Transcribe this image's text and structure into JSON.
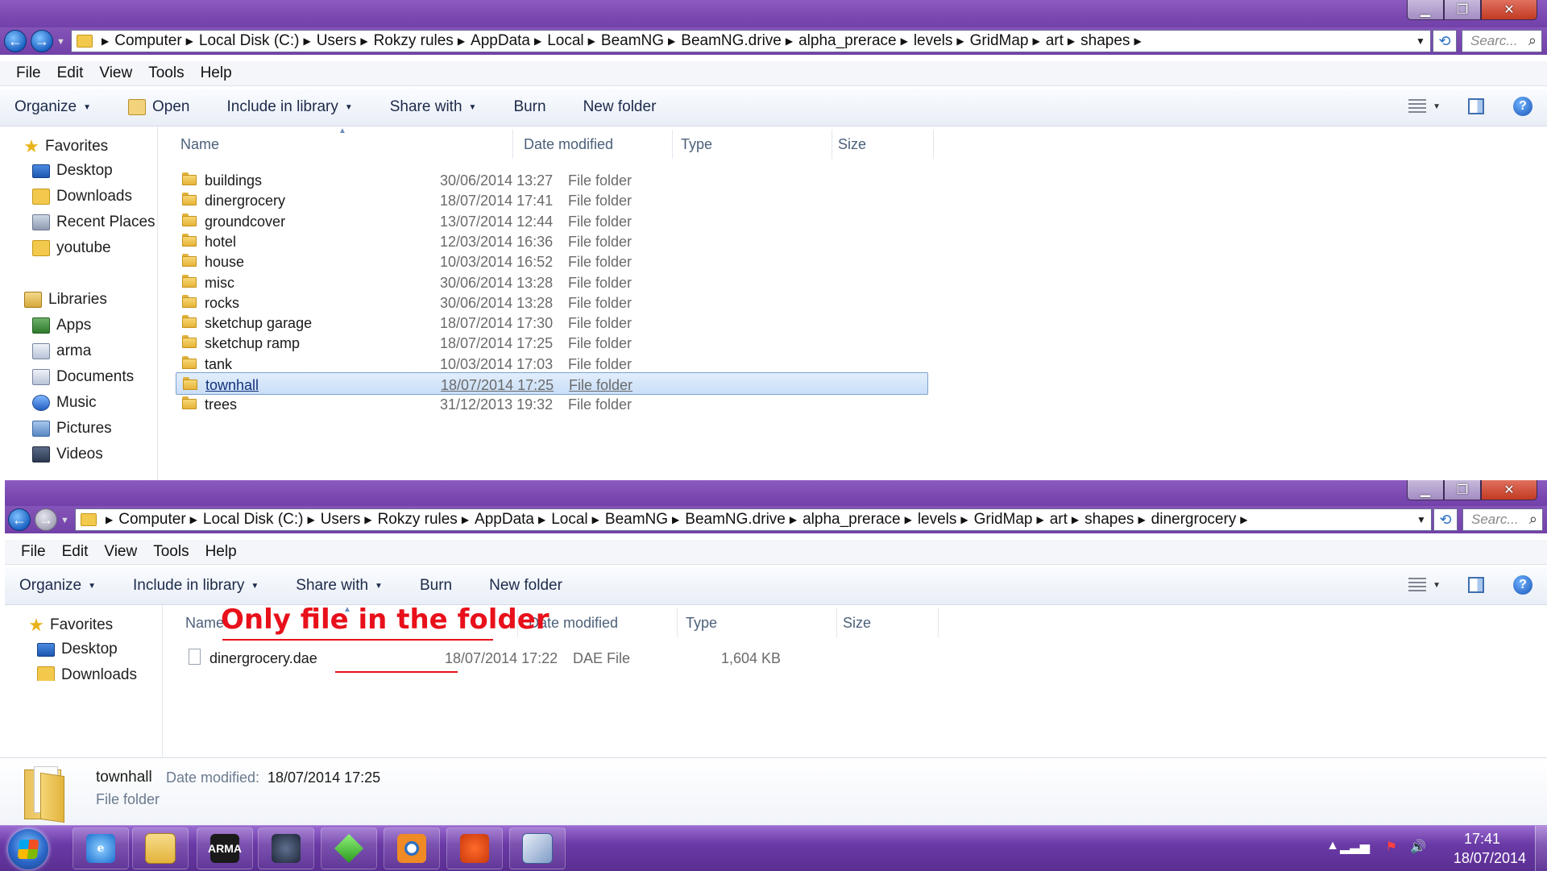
{
  "window1": {
    "breadcrumbs": [
      "Computer",
      "Local Disk (C:)",
      "Users",
      "Rokzy rules",
      "AppData",
      "Local",
      "BeamNG",
      "BeamNG.drive",
      "alpha_prerace",
      "levels",
      "GridMap",
      "art",
      "shapes"
    ],
    "search_placeholder": "Searc...",
    "menu": [
      "File",
      "Edit",
      "View",
      "Tools",
      "Help"
    ],
    "toolbar": {
      "organize": "Organize",
      "open": "Open",
      "include": "Include in library",
      "share": "Share with",
      "burn": "Burn",
      "new_folder": "New folder"
    },
    "nav": {
      "favorites_label": "Favorites",
      "favorites": [
        "Desktop",
        "Downloads",
        "Recent Places",
        "youtube"
      ],
      "libraries_label": "Libraries",
      "libraries": [
        "Apps",
        "arma",
        "Documents",
        "Music",
        "Pictures",
        "Videos"
      ]
    },
    "columns": {
      "name": "Name",
      "date": "Date modified",
      "type": "Type",
      "size": "Size"
    },
    "files": [
      {
        "name": "buildings",
        "date": "30/06/2014 13:27",
        "type": "File folder"
      },
      {
        "name": "dinergrocery",
        "date": "18/07/2014 17:41",
        "type": "File folder"
      },
      {
        "name": "groundcover",
        "date": "13/07/2014 12:44",
        "type": "File folder"
      },
      {
        "name": "hotel",
        "date": "12/03/2014 16:36",
        "type": "File folder"
      },
      {
        "name": "house",
        "date": "10/03/2014 16:52",
        "type": "File folder"
      },
      {
        "name": "misc",
        "date": "30/06/2014 13:28",
        "type": "File folder"
      },
      {
        "name": "rocks",
        "date": "30/06/2014 13:28",
        "type": "File folder"
      },
      {
        "name": "sketchup garage",
        "date": "18/07/2014 17:30",
        "type": "File folder"
      },
      {
        "name": "sketchup ramp",
        "date": "18/07/2014 17:25",
        "type": "File folder"
      },
      {
        "name": "tank",
        "date": "10/03/2014 17:03",
        "type": "File folder"
      },
      {
        "name": "townhall",
        "date": "18/07/2014 17:25",
        "type": "File folder"
      },
      {
        "name": "trees",
        "date": "31/12/2013 19:32",
        "type": "File folder"
      }
    ]
  },
  "window2": {
    "breadcrumbs": [
      "Computer",
      "Local Disk (C:)",
      "Users",
      "Rokzy rules",
      "AppData",
      "Local",
      "BeamNG",
      "BeamNG.drive",
      "alpha_prerace",
      "levels",
      "GridMap",
      "art",
      "shapes",
      "dinergrocery"
    ],
    "search_placeholder": "Searc...",
    "menu": [
      "File",
      "Edit",
      "View",
      "Tools",
      "Help"
    ],
    "toolbar": {
      "organize": "Organize",
      "include": "Include in library",
      "share": "Share with",
      "burn": "Burn",
      "new_folder": "New folder"
    },
    "nav": {
      "favorites_label": "Favorites",
      "favorites": [
        "Desktop",
        "Downloads"
      ]
    },
    "columns": {
      "name": "Name",
      "date": "Date modified",
      "type": "Type",
      "size": "Size"
    },
    "files": [
      {
        "name": "dinergrocery.dae",
        "date": "18/07/2014 17:22",
        "type": "DAE File",
        "size": "1,604 KB"
      }
    ],
    "annotation": "Only file in the folder"
  },
  "details": {
    "name": "townhall",
    "date_label": "Date modified:",
    "date_value": "18/07/2014 17:25",
    "type": "File folder"
  },
  "taskbar": {
    "time": "17:41",
    "date": "18/07/2014"
  },
  "colors": {
    "title_purple": "#7a47b0",
    "selection": "#cde0f7",
    "annotation_red": "#e8101a"
  }
}
